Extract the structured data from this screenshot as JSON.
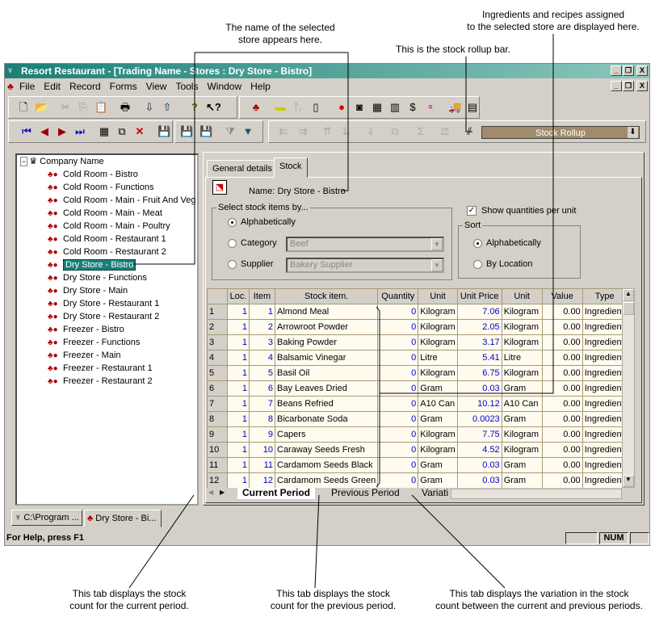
{
  "annotations": {
    "store_name": "The name of the selected\nstore appears here.",
    "ingredients": "Ingredients and recipes assigned\nto the selected store are displayed here.",
    "rollup": "This is the stock rollup bar.",
    "current_tab": "This tab displays the stock\ncount for the current period.",
    "previous_tab": "This tab displays the stock\ncount for the previous period.",
    "variation_tab": "This tab displays the variation in the stock\ncount between the current and previous periods."
  },
  "window": {
    "title": "Resort Restaurant - [Trading Name - Stores : Dry Store - Bistro]"
  },
  "menu": [
    "File",
    "Edit",
    "Record",
    "Forms",
    "View",
    "Tools",
    "Window",
    "Help"
  ],
  "rollup_bar": {
    "label": "Stock Rollup"
  },
  "tree": {
    "root": "Company Name",
    "items": [
      "Cold Room - Bistro",
      "Cold Room - Functions",
      "Cold Room - Main - Fruit And Veg",
      "Cold Room - Main - Meat",
      "Cold Room - Main - Poultry",
      "Cold Room - Restaurant 1",
      "Cold Room - Restaurant 2",
      "Dry Store - Bistro",
      "Dry Store - Functions",
      "Dry Store - Main",
      "Dry Store - Restaurant 1",
      "Dry Store - Restaurant 2",
      "Freezer - Bistro",
      "Freezer - Functions",
      "Freezer - Main",
      "Freezer - Restaurant 1",
      "Freezer - Restaurant 2"
    ],
    "selected": "Dry Store - Bistro"
  },
  "tabs": [
    "General details",
    "Stock"
  ],
  "active_tab": "Stock",
  "stock": {
    "name_label": "Name: Dry Store - Bistro",
    "select_by_label": "Select stock items by...",
    "alphabetically": "Alphabetically",
    "category": "Category",
    "category_value": "Beef",
    "supplier": "Supplier",
    "supplier_value": "Bakery Supplier",
    "show_qty": "Show quantities per unit",
    "show_qty_checked": true,
    "sort_label": "Sort",
    "sort_alpha": "Alphabetically",
    "sort_location": "By Location"
  },
  "grid": {
    "headers": [
      "",
      "Loc.",
      "Item",
      "Stock item.",
      "Quantity",
      "Unit",
      "Unit Price",
      "Unit",
      "Value",
      "Type"
    ],
    "rows": [
      [
        "1",
        "1",
        "1",
        "Almond Meal",
        "0",
        "Kilogram",
        "7.06",
        "Kilogram",
        "0.00",
        "Ingredient"
      ],
      [
        "2",
        "1",
        "2",
        "Arrowroot Powder",
        "0",
        "Kilogram",
        "2.05",
        "Kilogram",
        "0.00",
        "Ingredient"
      ],
      [
        "3",
        "1",
        "3",
        "Baking Powder",
        "0",
        "Kilogram",
        "3.17",
        "Kilogram",
        "0.00",
        "Ingredient"
      ],
      [
        "4",
        "1",
        "4",
        "Balsamic Vinegar",
        "0",
        "Litre",
        "5.41",
        "Litre",
        "0.00",
        "Ingredient"
      ],
      [
        "5",
        "1",
        "5",
        "Basil Oil",
        "0",
        "Kilogram",
        "6.75",
        "Kilogram",
        "0.00",
        "Ingredient"
      ],
      [
        "6",
        "1",
        "6",
        "Bay Leaves Dried",
        "0",
        "Gram",
        "0.03",
        "Gram",
        "0.00",
        "Ingredient"
      ],
      [
        "7",
        "1",
        "7",
        "Beans Refried",
        "0",
        "A10 Can",
        "10.12",
        "A10 Can",
        "0.00",
        "Ingredient"
      ],
      [
        "8",
        "1",
        "8",
        "Bicarbonate Soda",
        "0",
        "Gram",
        "0.0023",
        "Gram",
        "0.00",
        "Ingredient"
      ],
      [
        "9",
        "1",
        "9",
        "Capers",
        "0",
        "Kilogram",
        "7.75",
        "Kilogram",
        "0.00",
        "Ingredient"
      ],
      [
        "10",
        "1",
        "10",
        "Caraway Seeds Fresh",
        "0",
        "Kilogram",
        "4.52",
        "Kilogram",
        "0.00",
        "Ingredient"
      ],
      [
        "11",
        "1",
        "11",
        "Cardamom Seeds Black",
        "0",
        "Gram",
        "0.03",
        "Gram",
        "0.00",
        "Ingredient"
      ],
      [
        "12",
        "1",
        "12",
        "Cardamom Seeds Green",
        "0",
        "Gram",
        "0.03",
        "Gram",
        "0.00",
        "Ingredient"
      ]
    ],
    "period_tabs": [
      "Current Period",
      "Previous Period",
      "Variati"
    ]
  },
  "taskbar": [
    "C:\\Program ...",
    "Dry Store - Bi..."
  ],
  "status": {
    "help": "For Help, press F1",
    "num": "NUM"
  }
}
